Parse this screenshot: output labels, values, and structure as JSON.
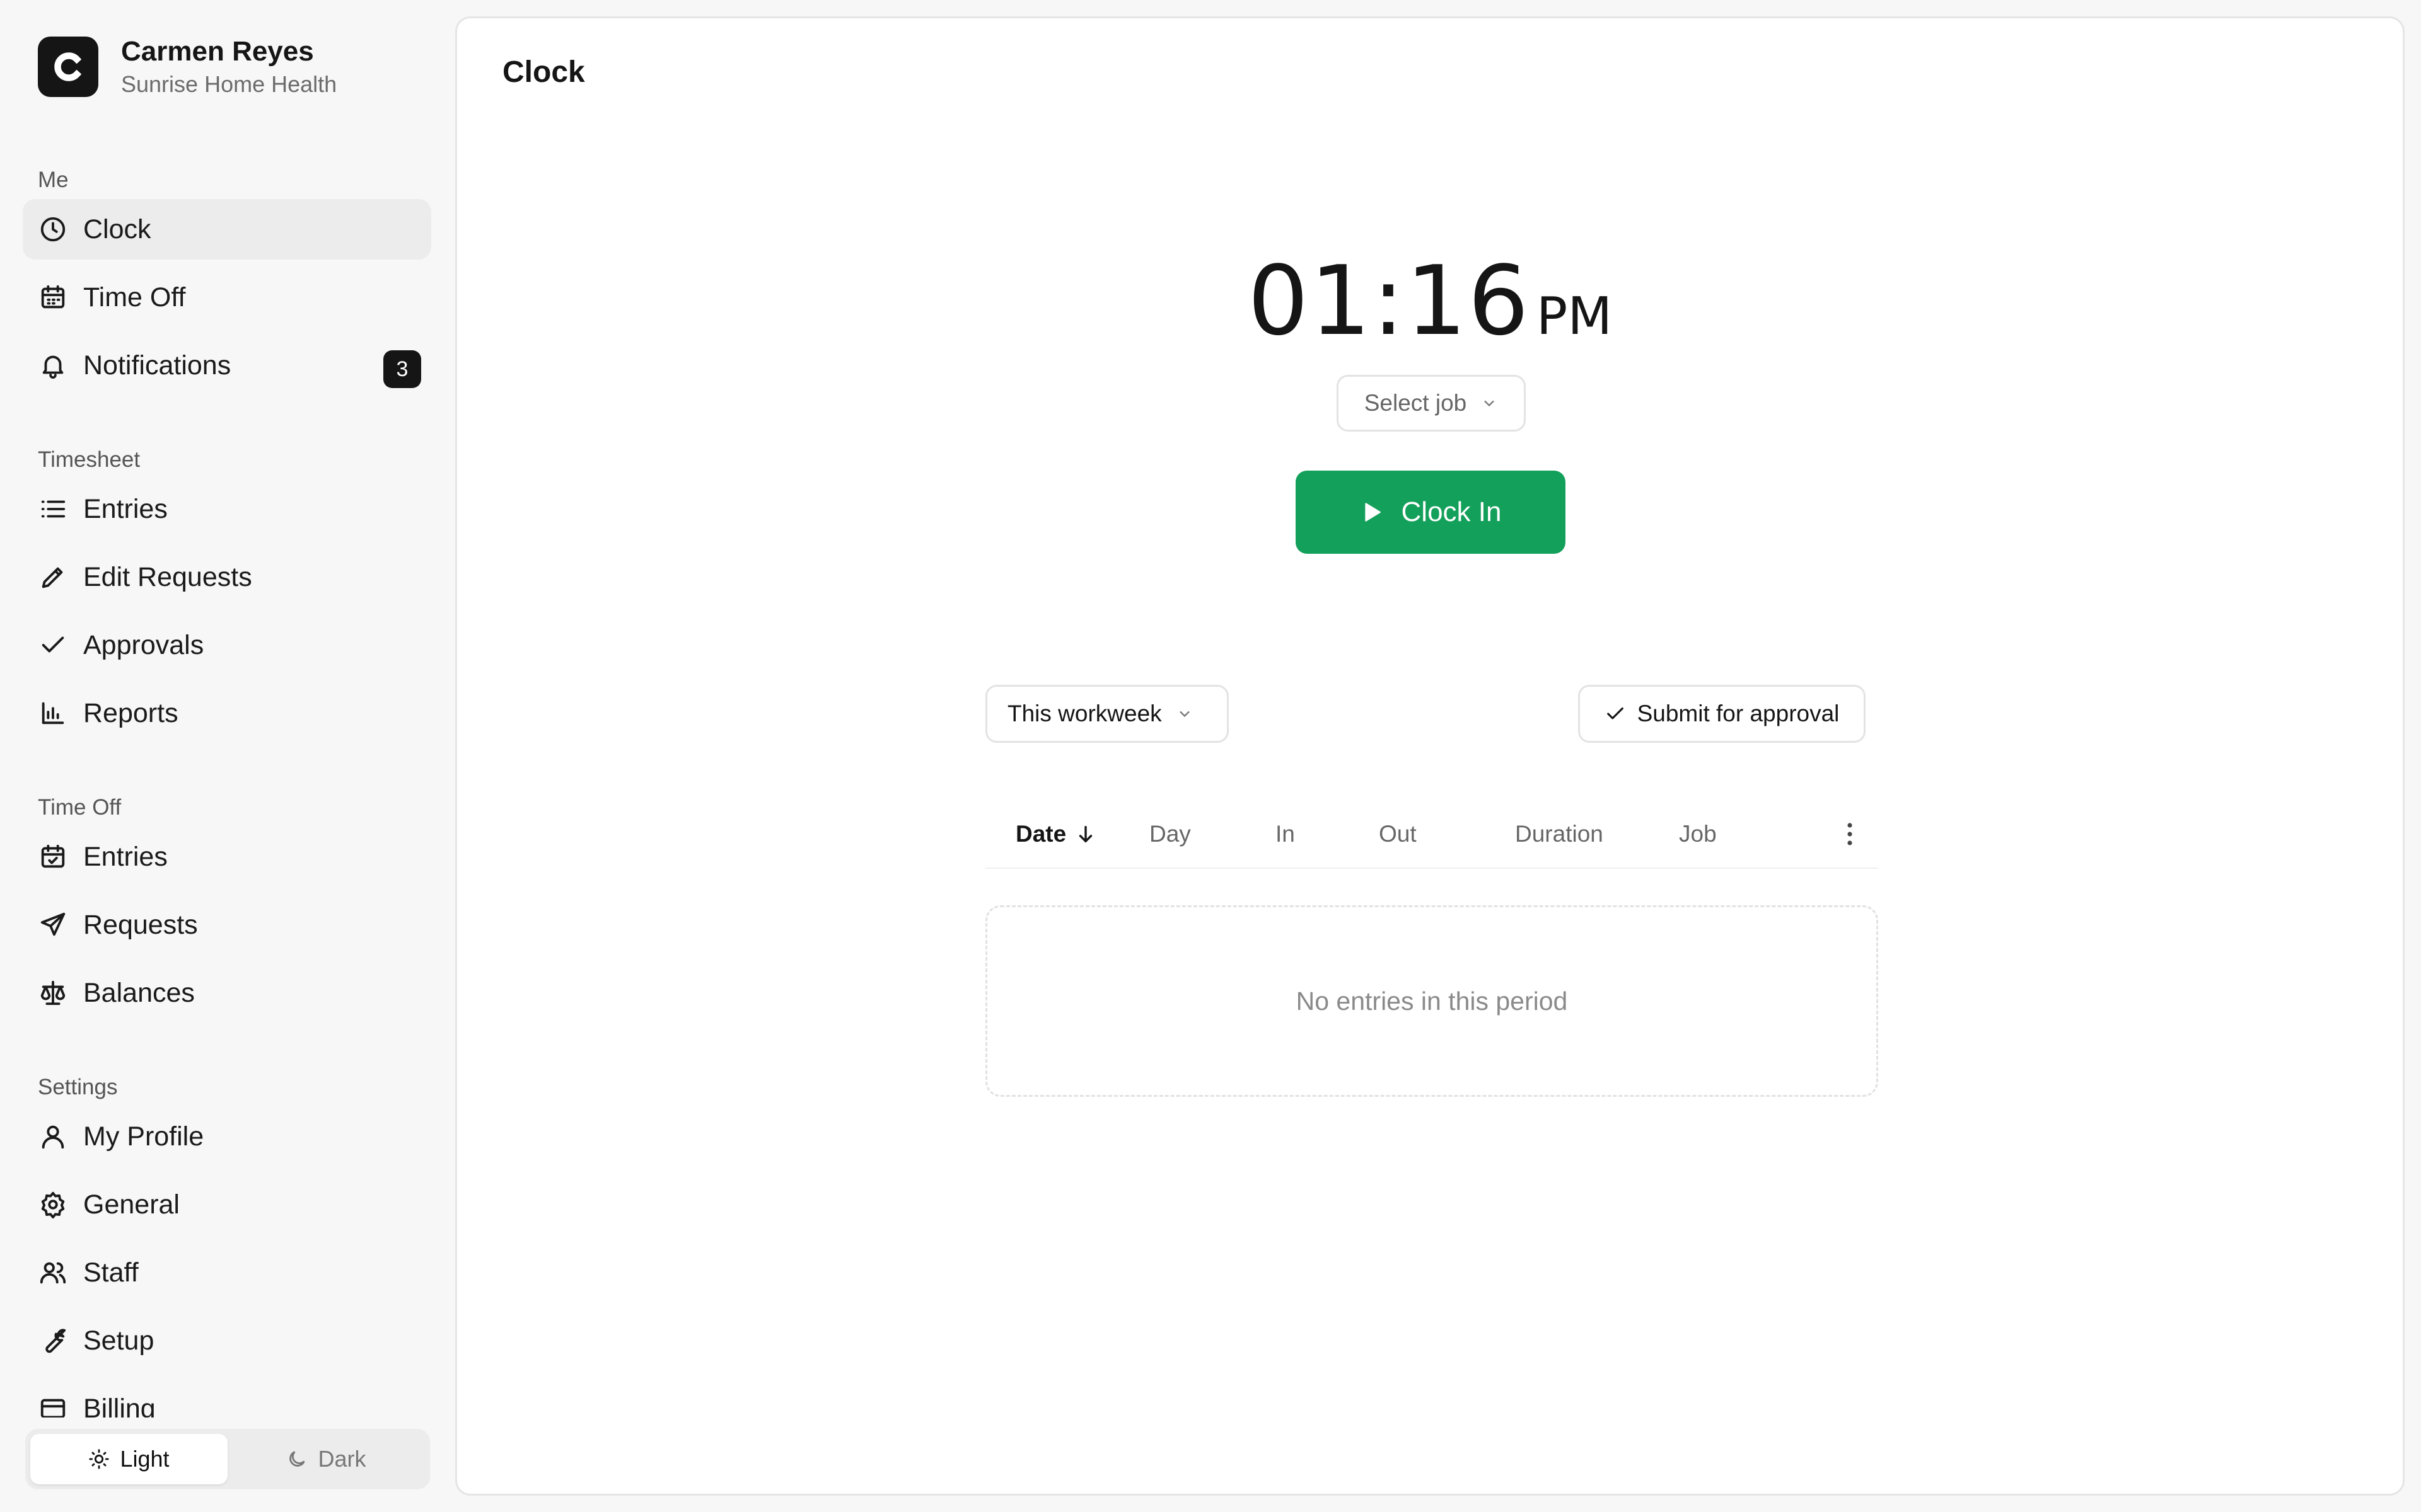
{
  "brand": {
    "logo_letter": "C",
    "user_name": "Carmen Reyes",
    "org_name": "Sunrise Home Health"
  },
  "sidebar": {
    "sections": [
      {
        "title": "Me",
        "items": [
          {
            "label": "Clock",
            "icon": "clock-icon",
            "active": true
          },
          {
            "label": "Time Off",
            "icon": "calendar-icon"
          },
          {
            "label": "Notifications",
            "icon": "bell-icon",
            "badge": "3"
          }
        ]
      },
      {
        "title": "Timesheet",
        "items": [
          {
            "label": "Entries",
            "icon": "list-icon"
          },
          {
            "label": "Edit Requests",
            "icon": "pencil-icon"
          },
          {
            "label": "Approvals",
            "icon": "check-icon"
          },
          {
            "label": "Reports",
            "icon": "bar-chart-icon"
          }
        ]
      },
      {
        "title": "Time Off",
        "items": [
          {
            "label": "Entries",
            "icon": "calendar-check-icon"
          },
          {
            "label": "Requests",
            "icon": "send-icon"
          },
          {
            "label": "Balances",
            "icon": "scale-icon"
          }
        ]
      },
      {
        "title": "Settings",
        "items": [
          {
            "label": "My Profile",
            "icon": "user-icon"
          },
          {
            "label": "General",
            "icon": "gear-icon"
          },
          {
            "label": "Staff",
            "icon": "users-icon"
          },
          {
            "label": "Setup",
            "icon": "wrench-icon"
          },
          {
            "label": "Billing",
            "icon": "credit-card-icon"
          }
        ]
      }
    ]
  },
  "theme": {
    "light_label": "Light",
    "dark_label": "Dark",
    "selected": "Light"
  },
  "main": {
    "title": "Clock",
    "clock": {
      "time": "01:16",
      "ampm": "PM"
    },
    "job_select": {
      "placeholder": "Select job"
    },
    "clock_in_label": "Clock In",
    "period_select": {
      "value": "This workweek"
    },
    "submit_label": "Submit for approval",
    "table": {
      "columns": [
        "Date",
        "Day",
        "In",
        "Out",
        "Duration",
        "Job"
      ],
      "sorted_column": "Date",
      "sort_direction": "descending",
      "rows": []
    },
    "empty_message": "No entries in this period"
  },
  "colors": {
    "accent": "#13a05a",
    "badge": "#151515",
    "active_nav": "#ececec"
  }
}
